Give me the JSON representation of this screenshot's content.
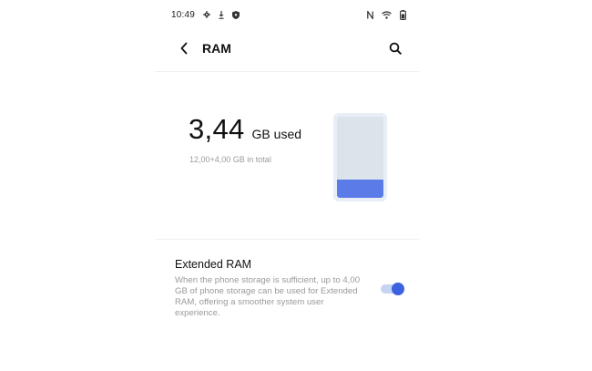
{
  "status_bar": {
    "time": "10:49",
    "left_icons": [
      "settings-gear-icon",
      "download-icon",
      "shield-icon"
    ],
    "right_icons": [
      "nfc-icon",
      "wifi-icon",
      "battery-icon"
    ]
  },
  "header": {
    "title": "RAM",
    "back_icon": "chevron-left-icon",
    "search_icon": "search-icon"
  },
  "ram": {
    "used_value": "3,44",
    "used_unit": "GB used",
    "total_text": "12,00+4,00 GB in total",
    "fill_fraction": 0.22,
    "colors": {
      "fill": "#5b7be8",
      "card": "#e8eef6"
    }
  },
  "extended_ram": {
    "title": "Extended RAM",
    "description": "When the phone storage is sufficient, up to 4,00 GB of phone storage can be used for Extended RAM, offering a smoother system user experience.",
    "enabled": true,
    "colors": {
      "thumb": "#3d62e0",
      "track": "#c7d3f3"
    }
  }
}
